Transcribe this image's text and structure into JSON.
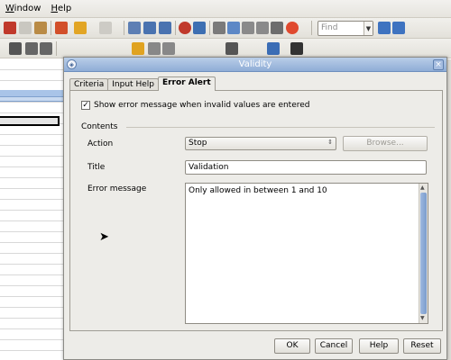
{
  "menubar": {
    "window_label": "Window",
    "window_mnemonic": "W",
    "window_rest": "indow",
    "help_label": "Help",
    "help_mnemonic": "H",
    "help_rest": "elp"
  },
  "toolbar": {
    "find_placeholder": "Find"
  },
  "dialog": {
    "title": "Validity",
    "tabs": [
      {
        "label": "Criteria"
      },
      {
        "label": "Input Help"
      },
      {
        "label": "Error Alert"
      }
    ],
    "show_error_checkbox": {
      "label": "Show error message when invalid values are entered",
      "checked": true
    },
    "contents_section_label": "Contents",
    "action_label": "Action",
    "action_value": "Stop",
    "browse_button": "Browse...",
    "title_label": "Title",
    "title_value": "Validation",
    "error_message_label": "Error message",
    "error_message_value": "Only allowed in between 1 and 10",
    "buttons": {
      "ok": "OK",
      "cancel": "Cancel",
      "help": "Help",
      "reset": "Reset"
    }
  },
  "colors": {
    "titlebar": "#9ab5dc",
    "scroll_thumb": "#8aa9d5",
    "dialog_bg": "#edece8"
  }
}
